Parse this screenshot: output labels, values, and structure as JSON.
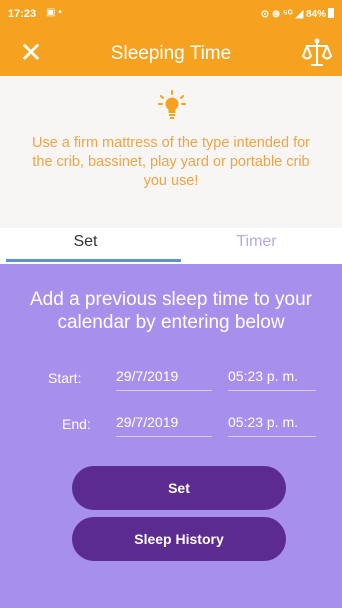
{
  "status_bar": {
    "time": "17:23",
    "left_icons": "▣ •",
    "right_icons": "⊙ ⊛ ⁵ᴳ ◢ 84%"
  },
  "app_bar": {
    "close_glyph": "✕",
    "title": "Sleeping Time",
    "right_icon": "scale-icon"
  },
  "tip": {
    "icon": "lightbulb-icon",
    "text": "Use a firm mattress of the type intended for the crib, bassinet, play yard or portable crib you use!"
  },
  "tabs": [
    {
      "label": "Set",
      "active": true
    },
    {
      "label": "Timer",
      "active": false
    }
  ],
  "form": {
    "instructions": "Add a previous sleep time to your calendar by entering below",
    "start_label": "Start:",
    "start_date": "29/7/2019",
    "start_time": "05:23 p. m.",
    "end_label": "End:",
    "end_date": "29/7/2019",
    "end_time": "05:23 p. m."
  },
  "buttons": {
    "set_label": "Set",
    "history_label": "Sleep History"
  },
  "colors": {
    "accent_orange": "#f4a21f",
    "tip_text": "#f0a347",
    "panel_purple": "#a690ec",
    "button_purple": "#5b2b8f",
    "tab_underline": "#5e90d8"
  }
}
